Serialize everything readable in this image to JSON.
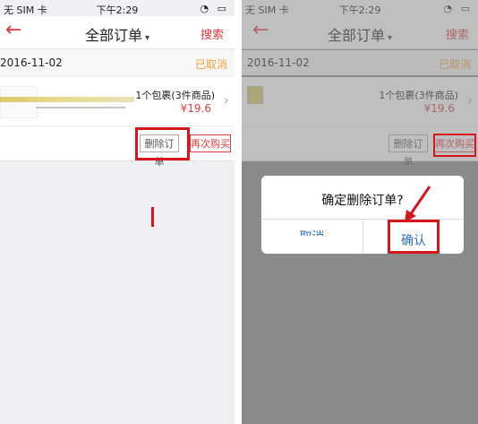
{
  "status": {
    "carrier": "无 SIM 卡",
    "time": "下午2:29"
  },
  "nav": {
    "back": "←",
    "title": "全部订单",
    "caret": "▾",
    "search": "搜索"
  },
  "order": {
    "date": "2016-11-02",
    "status": "已取消",
    "summary": "1个包裹(3件商品)",
    "price": "¥19.6",
    "chevron": "›",
    "delete_label": "删除订单",
    "rebuy_label": "再次购买"
  },
  "dialog": {
    "message": "确定删除订单?",
    "cancel": "取消",
    "confirm": "确认"
  },
  "colors": {
    "accent": "#e4393c",
    "highlight": "#d6151c",
    "cancelled": "#f0a23a",
    "dialog_button": "#2f6ec7"
  }
}
